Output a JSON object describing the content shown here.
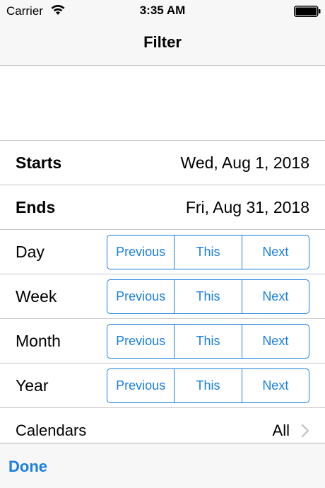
{
  "status": {
    "carrier": "Carrier",
    "time": "3:35 AM"
  },
  "nav": {
    "title": "Filter"
  },
  "starts": {
    "label": "Starts",
    "value": "Wed, Aug 1, 2018"
  },
  "ends": {
    "label": "Ends",
    "value": "Fri, Aug 31, 2018"
  },
  "periods": [
    {
      "label": "Day",
      "previous": "Previous",
      "this": "This",
      "next": "Next"
    },
    {
      "label": "Week",
      "previous": "Previous",
      "this": "This",
      "next": "Next"
    },
    {
      "label": "Month",
      "previous": "Previous",
      "this": "This",
      "next": "Next"
    },
    {
      "label": "Year",
      "previous": "Previous",
      "this": "This",
      "next": "Next"
    }
  ],
  "calendars": {
    "label": "Calendars",
    "value": "All"
  },
  "toolbar": {
    "done_label": "Done"
  },
  "colors": {
    "accent": "#1a7fe0",
    "separator": "#c8c7cc",
    "bar": "#f7f7f7"
  }
}
